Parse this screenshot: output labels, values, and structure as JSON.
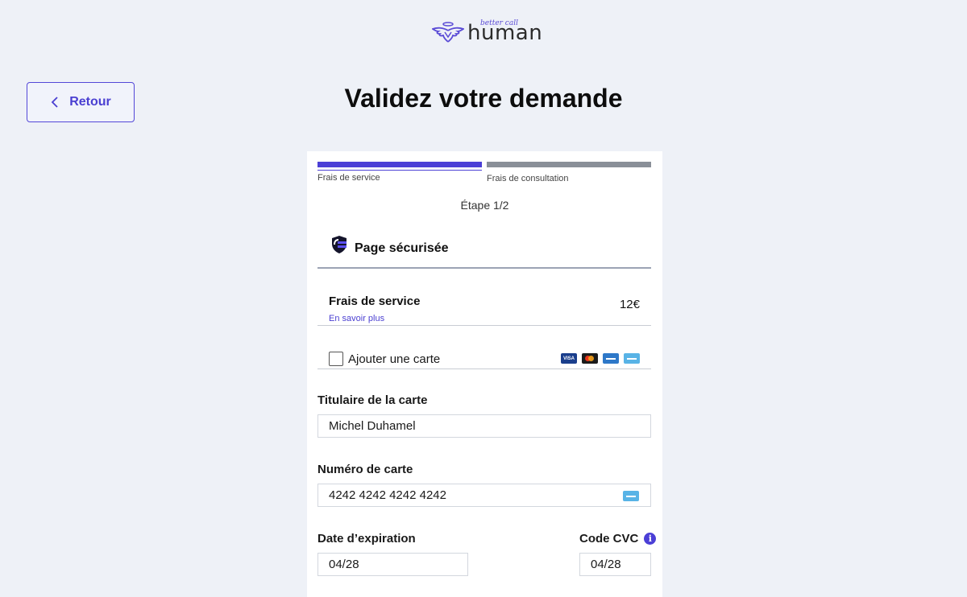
{
  "logo": {
    "tagline": "better call",
    "word": "human"
  },
  "back_button": {
    "label": "Retour"
  },
  "page_title": "Validez votre demande",
  "steps": [
    {
      "label": "Frais de service"
    },
    {
      "label": "Frais de consultation"
    }
  ],
  "step_count": "Étape 1/2",
  "secure": {
    "label": "Page sécurisée"
  },
  "fee": {
    "label": "Frais de service",
    "link": "En savoir plus",
    "amount": "12€"
  },
  "add_card": {
    "label": "Ajouter une carte",
    "brands": [
      "VISA",
      "mastercard",
      "amex",
      "card"
    ]
  },
  "form": {
    "holder_label": "Titulaire de la carte",
    "holder_value": "Michel Duhamel",
    "number_label": "Numéro de carte",
    "number_value": "4242 4242 4242 4242",
    "expiry_label": "Date d’expiration",
    "expiry_value": "04/28",
    "cvc_label": "Code CVC",
    "cvc_value": "04/28"
  },
  "colors": {
    "accent": "#4b3fd6",
    "background": "#eef1f7",
    "inactive_step": "#8a8f98"
  }
}
